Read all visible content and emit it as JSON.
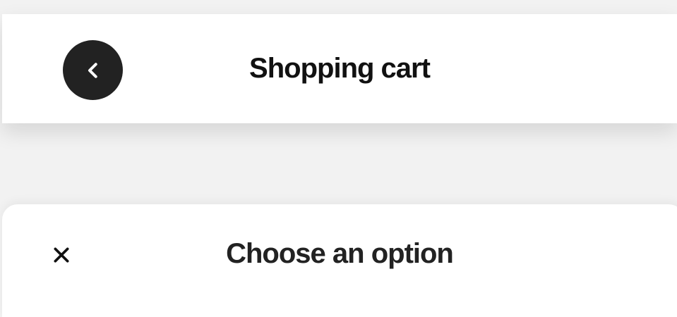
{
  "header": {
    "title": "Shopping cart",
    "back_icon": "chevron-left-icon"
  },
  "sheet": {
    "title": "Choose an option",
    "close_icon": "close-icon"
  },
  "colors": {
    "background": "#f2f2f2",
    "surface": "#ffffff",
    "back_button": "#222222",
    "text": "#111111"
  }
}
